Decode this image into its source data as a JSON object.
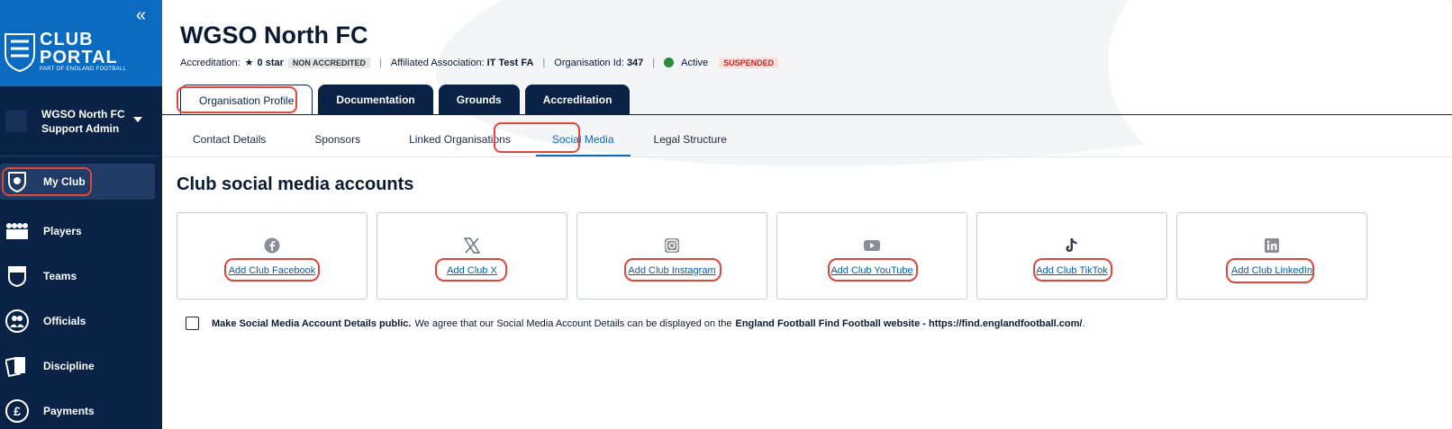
{
  "sidebar": {
    "logo": {
      "line1": "CLUB",
      "line2": "PORTAL",
      "line3": "PART OF ENGLAND FOOTBALL"
    },
    "org": {
      "name": "WGSO North FC",
      "role": "Support Admin"
    },
    "items": [
      {
        "label": "My Club",
        "icon": "club-crest-icon"
      },
      {
        "label": "Players",
        "icon": "players-icon"
      },
      {
        "label": "Teams",
        "icon": "shirt-icon"
      },
      {
        "label": "Officials",
        "icon": "officials-icon"
      },
      {
        "label": "Discipline",
        "icon": "cards-icon"
      },
      {
        "label": "Payments",
        "icon": "pound-icon"
      }
    ]
  },
  "header": {
    "title": "WGSO North FC",
    "accreditation_label": "Accreditation:",
    "accreditation_value": "0 star",
    "accreditation_badge": "NON ACCREDITED",
    "association_label": "Affiliated Association:",
    "association_value": "IT Test FA",
    "org_id_label": "Organisation Id:",
    "org_id_value": "347",
    "status": "Active",
    "status_badge": "SUSPENDED"
  },
  "tabs": [
    "Organisation Profile",
    "Documentation",
    "Grounds",
    "Accreditation"
  ],
  "subtabs": [
    "Contact Details",
    "Sponsors",
    "Linked Organisations",
    "Social Media",
    "Legal Structure"
  ],
  "section_title": "Club social media accounts",
  "cards": [
    {
      "label": "Add Club Facebook",
      "icon": "facebook-icon"
    },
    {
      "label": "Add Club X",
      "icon": "x-icon"
    },
    {
      "label": "Add Club Instagram",
      "icon": "instagram-icon"
    },
    {
      "label": "Add Club YouTube",
      "icon": "youtube-icon"
    },
    {
      "label": "Add Club TikTok",
      "icon": "tiktok-icon"
    },
    {
      "label": "Add Club LinkedIn",
      "icon": "linkedin-icon"
    }
  ],
  "consent": {
    "bold": "Make Social Media Account Details public.",
    "text": "We agree that our Social Media Account Details can be displayed on the",
    "bold2": "England Football Find Football website - https://find.englandfootball.com/",
    "end": "."
  },
  "colors": {
    "sidebar": "#0b2247",
    "brand": "#0a6bc0",
    "highlight": "#e0463a"
  }
}
